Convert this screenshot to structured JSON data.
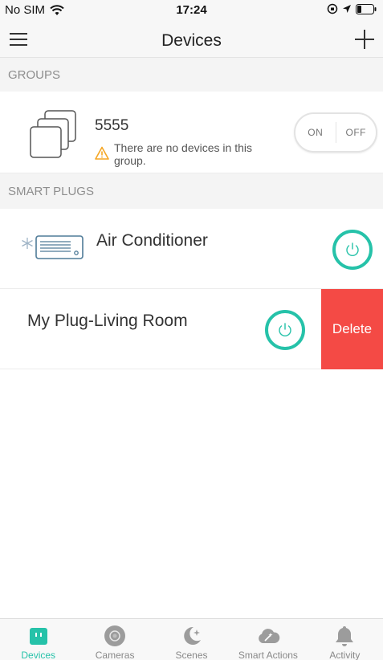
{
  "status_bar": {
    "carrier": "No SIM",
    "time": "17:24"
  },
  "nav": {
    "title": "Devices"
  },
  "groups": {
    "header": "GROUPS",
    "items": [
      {
        "name": "5555",
        "warning": "There are no devices in this group.",
        "toggle_on": "ON",
        "toggle_off": "OFF"
      }
    ]
  },
  "smart_plugs": {
    "header": "SMART PLUGS",
    "items": [
      {
        "name": "Air Conditioner",
        "icon": "air-conditioner-icon"
      },
      {
        "name": "My Plug-Living Room",
        "icon": "plug-icon",
        "delete_label": "Delete"
      }
    ]
  },
  "tabs": [
    {
      "label": "Devices",
      "icon": "devices-icon",
      "active": true
    },
    {
      "label": "Cameras",
      "icon": "camera-icon",
      "active": false
    },
    {
      "label": "Scenes",
      "icon": "scenes-icon",
      "active": false
    },
    {
      "label": "Smart Actions",
      "icon": "smart-actions-icon",
      "active": false
    },
    {
      "label": "Activity",
      "icon": "bell-icon",
      "active": false
    }
  ],
  "colors": {
    "accent": "#26c2a9",
    "delete": "#f44a45",
    "warning": "#f5a623"
  }
}
